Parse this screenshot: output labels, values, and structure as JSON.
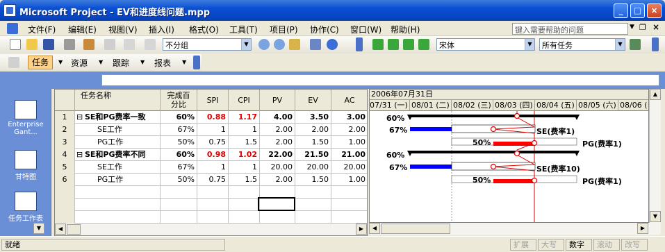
{
  "window": {
    "title": "Microsoft Project - EV和进度线问题.mpp"
  },
  "menu": {
    "items": [
      "文件(F)",
      "编辑(E)",
      "视图(V)",
      "插入(I)",
      "格式(O)",
      "工具(T)",
      "项目(P)",
      "协作(C)",
      "窗口(W)",
      "帮助(H)"
    ],
    "help_placeholder": "键入需要帮助的问题"
  },
  "toolbar": {
    "group_combo": "不分组",
    "font_combo": "宋体",
    "filter_combo": "所有任务"
  },
  "toolbar3": {
    "buttons": [
      "任务",
      "资源",
      "跟踪",
      "报表"
    ]
  },
  "viewbar": {
    "items": [
      "Enterprise Gant...",
      "甘特图",
      "任务工作表"
    ]
  },
  "table": {
    "headers": [
      "任务名称",
      "完成百分比",
      "SPI",
      "CPI",
      "PV",
      "EV",
      "AC"
    ],
    "rows": [
      {
        "num": "1",
        "name": "SE和PG费率一致",
        "pct": "60%",
        "spi": "0.88",
        "cpi": "1.17",
        "pv": "4.00",
        "ev": "3.50",
        "ac": "3.00",
        "summary": true
      },
      {
        "num": "2",
        "name": "SE工作",
        "pct": "67%",
        "spi": "1",
        "cpi": "1",
        "pv": "2.00",
        "ev": "2.00",
        "ac": "2.00",
        "summary": false
      },
      {
        "num": "3",
        "name": "PG工作",
        "pct": "50%",
        "spi": "0.75",
        "cpi": "1.5",
        "pv": "2.00",
        "ev": "1.50",
        "ac": "1.00",
        "summary": false
      },
      {
        "num": "4",
        "name": "SE和PG费率不同",
        "pct": "60%",
        "spi": "0.98",
        "cpi": "1.02",
        "pv": "22.00",
        "ev": "21.50",
        "ac": "21.00",
        "summary": true
      },
      {
        "num": "5",
        "name": "SE工作",
        "pct": "67%",
        "spi": "1",
        "cpi": "1",
        "pv": "20.00",
        "ev": "20.00",
        "ac": "20.00",
        "summary": false
      },
      {
        "num": "6",
        "name": "PG工作",
        "pct": "50%",
        "spi": "0.75",
        "cpi": "1.5",
        "pv": "2.00",
        "ev": "1.50",
        "ac": "1.00",
        "summary": false
      }
    ]
  },
  "gantt": {
    "week_label": "2006年07月31日",
    "days": [
      "07/31 (一)",
      "08/01 (二)",
      "08/02 (三)",
      "08/03 (四)",
      "08/04 (五)",
      "08/05 (六)",
      "08/06 (日"
    ],
    "labels": {
      "r1_pct": "60%",
      "r2_pct": "67%",
      "r2_name": "SE(费率1)",
      "r3_pct": "50%",
      "r3_name": "PG(费率1)",
      "r4_pct": "60%",
      "r5_pct": "67%",
      "r5_name": "SE(费率10)",
      "r6_pct": "50%",
      "r6_name": "PG(费率1)"
    }
  },
  "status": {
    "ready": "就绪",
    "panels": [
      "扩展",
      "大写",
      "数字",
      "滚动",
      "改写"
    ]
  },
  "colors": {
    "title_bar": "#0a4fd4",
    "progress_blue": "#0000ff",
    "progress_red": "#ff0000",
    "status_line": "#e00000"
  }
}
